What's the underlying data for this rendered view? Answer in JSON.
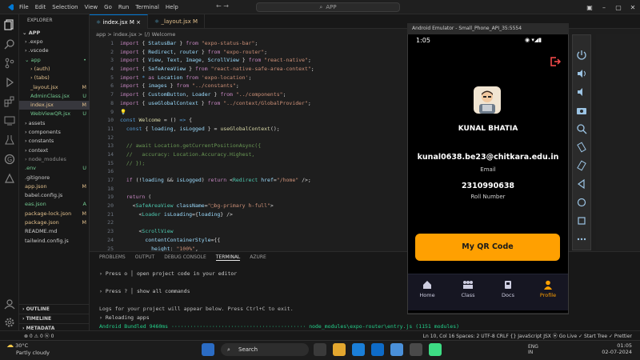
{
  "window": {
    "menu": [
      "File",
      "Edit",
      "Selection",
      "View",
      "Go",
      "Run",
      "Terminal",
      "Help"
    ],
    "search_text": "APP"
  },
  "explorer": {
    "header": "EXPLORER",
    "root": "APP",
    "items": [
      {
        "label": "› .expo",
        "depth": 1,
        "color": "#cccccc",
        "badge": ""
      },
      {
        "label": "› .vscode",
        "depth": 1,
        "color": "#cccccc",
        "badge": ""
      },
      {
        "label": "⌄ app",
        "depth": 1,
        "color": "#73c991",
        "badge": "•"
      },
      {
        "label": "› (auth)",
        "depth": 2,
        "color": "#e2c08d",
        "badge": ""
      },
      {
        "label": "› (tabs)",
        "depth": 2,
        "color": "#e2c08d",
        "badge": ""
      },
      {
        "label": "_layout.jsx",
        "depth": 2,
        "color": "#e2c08d",
        "badge": "M"
      },
      {
        "label": "AdminClass.jsx",
        "depth": 2,
        "color": "#73c991",
        "badge": "U"
      },
      {
        "label": "index.jsx",
        "depth": 2,
        "color": "#e2c08d",
        "badge": "M"
      },
      {
        "label": "WebViewQR.jsx",
        "depth": 2,
        "color": "#73c991",
        "badge": "U"
      },
      {
        "label": "› assets",
        "depth": 1,
        "color": "#cccccc",
        "badge": ""
      },
      {
        "label": "› components",
        "depth": 1,
        "color": "#cccccc",
        "badge": ""
      },
      {
        "label": "› constants",
        "depth": 1,
        "color": "#cccccc",
        "badge": ""
      },
      {
        "label": "› context",
        "depth": 1,
        "color": "#cccccc",
        "badge": ""
      },
      {
        "label": "› node_modules",
        "depth": 1,
        "color": "#8c8c8c",
        "badge": ""
      },
      {
        "label": ".env",
        "depth": 1,
        "color": "#73c991",
        "badge": "U"
      },
      {
        "label": ".gitignore",
        "depth": 1,
        "color": "#cccccc",
        "badge": ""
      },
      {
        "label": "app.json",
        "depth": 1,
        "color": "#e2c08d",
        "badge": "M"
      },
      {
        "label": "babel.config.js",
        "depth": 1,
        "color": "#cccccc",
        "badge": ""
      },
      {
        "label": "eas.json",
        "depth": 1,
        "color": "#73c991",
        "badge": "A"
      },
      {
        "label": "package-lock.json",
        "depth": 1,
        "color": "#e2c08d",
        "badge": "M"
      },
      {
        "label": "package.json",
        "depth": 1,
        "color": "#e2c08d",
        "badge": "M"
      },
      {
        "label": "README.md",
        "depth": 1,
        "color": "#cccccc",
        "badge": ""
      },
      {
        "label": "tailwind.config.js",
        "depth": 1,
        "color": "#cccccc",
        "badge": ""
      }
    ],
    "sections": [
      "OUTLINE",
      "TIMELINE",
      "METADATA"
    ]
  },
  "tabs": [
    {
      "label": "index.jsx  M  ×",
      "active": true
    },
    {
      "label": "_layout.jsx  M",
      "active": false
    }
  ],
  "breadcrumb": "app > index.jsx > ⟨/⟩ Welcome",
  "line_numbers": [
    "1",
    "2",
    "3",
    "4",
    "5",
    "6",
    "7",
    "8",
    "9",
    "10",
    "11",
    "12",
    "13",
    "14",
    "15",
    "16",
    "17",
    "18",
    "19",
    "20",
    "21",
    "22",
    "23",
    "24",
    "25",
    "26"
  ],
  "code_lines": [
    "<span class='k'>import</span> <span class='p'>{</span> <span class='v'>StatusBar</span> <span class='p'>}</span> <span class='k'>from</span> <span class='s'>\"expo-status-bar\"</span><span class='p'>;</span>",
    "<span class='k'>import</span> <span class='p'>{</span> <span class='v'>Redirect</span><span class='p'>,</span> <span class='v'>router</span> <span class='p'>}</span> <span class='k'>from</span> <span class='s'>\"expo-router\"</span><span class='p'>;</span>",
    "<span class='k'>import</span> <span class='p'>{</span> <span class='v'>View</span><span class='p'>,</span> <span class='v'>Text</span><span class='p'>,</span> <span class='v'>Image</span><span class='p'>,</span> <span class='v'>ScrollView</span> <span class='p'>}</span> <span class='k'>from</span> <span class='s'>\"react-native\"</span><span class='p'>;</span>",
    "<span class='k'>import</span> <span class='p'>{</span> <span class='v'>SafeAreaView</span> <span class='p'>}</span> <span class='k'>from</span> <span class='s'>\"react-native-safe-area-context\"</span><span class='p'>;</span>",
    "<span class='k'>import</span> <span class='b'>*</span> <span class='k'>as</span> <span class='v'>Location</span> <span class='k'>from</span> <span class='s'>'expo-location'</span><span class='p'>;</span>",
    "<span class='k'>import</span> <span class='p'>{</span> <span class='v'>images</span> <span class='p'>}</span> <span class='k'>from</span> <span class='s'>\"../constants\"</span><span class='p'>;</span>",
    "<span class='k'>import</span> <span class='p'>{</span> <span class='v'>CustomButton</span><span class='p'>,</span> <span class='v'>Loader</span> <span class='p'>}</span> <span class='k'>from</span> <span class='s'>\"../components\"</span><span class='p'>;</span>",
    "<span class='k'>import</span> <span class='p'>{</span> <span class='v'>useGlobalContext</span> <span class='p'>}</span> <span class='k'>from</span> <span class='s'>\"../context/GlobalProvider\"</span><span class='p'>;</span>",
    "<span class='f'>💡</span>",
    "<span class='b'>const</span> <span class='f'>Welcome</span> <span class='p'>=</span> <span class='p'>()</span> <span class='b'>=&gt;</span> <span class='p'>{</span>",
    "  <span class='b'>const</span> <span class='p'>{</span> <span class='v'>loading</span><span class='p'>,</span> <span class='v'>isLogged</span> <span class='p'>}</span> <span class='p'>=</span> <span class='f'>useGlobalContext</span><span class='p'>();</span>",
    "",
    "  <span class='c'>// await Location.getCurrentPositionAsync({</span>",
    "  <span class='c'>//   accuracy: Location.Accuracy.Highest,</span>",
    "  <span class='c'>// });</span>",
    "",
    "  <span class='k'>if</span> <span class='p'>(!</span><span class='v'>loading</span> <span class='p'>&amp;&amp;</span> <span class='v'>isLogged</span><span class='p'>)</span> <span class='k'>return</span> <span class='p'>&lt;</span><span class='t'>Redirect</span> <span class='v'>href</span><span class='p'>=</span><span class='s'>\"/home\"</span> <span class='p'>/&gt;;</span>",
    "",
    "  <span class='k'>return</span> <span class='p'>(</span>",
    "    <span class='p'>&lt;</span><span class='t'>SafeAreaView</span> <span class='v'>className</span><span class='p'>=</span><span class='s'>\"▢bg-primary h-full\"</span><span class='p'>&gt;</span>",
    "      <span class='p'>&lt;</span><span class='t'>Loader</span> <span class='v'>isLoading</span><span class='p'>={</span><span class='v'>loading</span><span class='p'>}</span> <span class='p'>/&gt;</span>",
    "",
    "      <span class='p'>&lt;</span><span class='t'>ScrollView</span>",
    "        <span class='v'>contentContainerStyle</span><span class='p'>={{</span>",
    "          <span class='v'>height</span><span class='p'>:</span> <span class='s'>\"100%\"</span><span class='p'>,</span>",
    "        <span class='p'>}}</span>"
  ],
  "panel": {
    "tabs": [
      "PROBLEMS",
      "OUTPUT",
      "DEBUG CONSOLE",
      "TERMINAL",
      "AZURE"
    ],
    "active_tab": "TERMINAL",
    "terminal_lines": [
      "› Press o │ open project code in your editor",
      "",
      "› Press ? │ show all commands",
      "",
      "Logs for your project will appear below. Press Ctrl+C to exit.",
      "› Reloading apps",
      "Android Bundled 9460ms ··········································· node_modules\\expo-router\\entry.js (1151 modules)"
    ]
  },
  "statusbar": {
    "left": "⊗ 0 ⚠ 0   ⓦ 0",
    "right": "Ln 10, Col 16   Spaces: 2   UTF-8   CRLF   {} JavaScript JSX   ⦿ Go Live   ✓ Start Tree   ✓ Prettier"
  },
  "emulator": {
    "title": "Android Emulator - Small_Phone_API_35:5554",
    "time": "1:05",
    "profile": {
      "name": "KUNAL BHATIA",
      "email": "kunal0638.be23@chitkara.edu.in",
      "email_label": "Email",
      "roll": "2310990638",
      "roll_label": "Roll Number"
    },
    "qr_button": "My QR Code",
    "nav": [
      {
        "label": "Home",
        "icon": "home-icon"
      },
      {
        "label": "Class",
        "icon": "class-icon"
      },
      {
        "label": "Docs",
        "icon": "docs-icon"
      },
      {
        "label": "Profile",
        "icon": "profile-icon"
      }
    ],
    "accent": "#ffa001"
  },
  "taskbar": {
    "weather_temp": "30°C",
    "weather_desc": "Partly cloudy",
    "search": "Search",
    "lang_top": "ENG",
    "lang_bottom": "IN",
    "time": "01:05",
    "date": "02-07-2024"
  }
}
